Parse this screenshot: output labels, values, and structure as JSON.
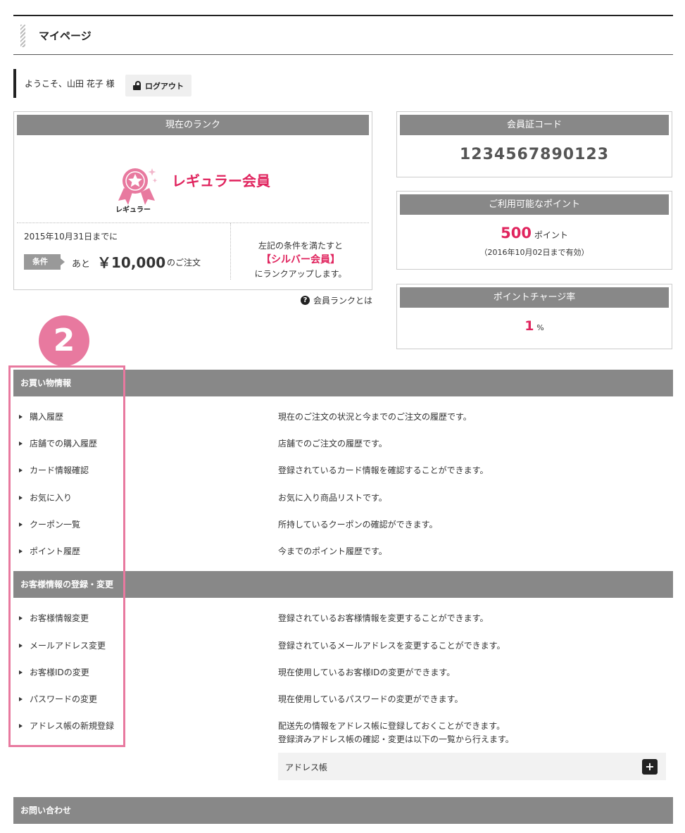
{
  "page": {
    "title": "マイページ"
  },
  "user": {
    "greeting": "ようこそ、山田 花子 様",
    "logout_label": "ログアウト"
  },
  "rank": {
    "header": "現在のランク",
    "badge_text": "レギュラー",
    "name": "レギュラー会員",
    "deadline": "2015年10月31日までに",
    "condition_label": "条件",
    "remain_prefix": "あと",
    "remain_amount": "￥10,000",
    "remain_suffix": "のご注文",
    "upgrade_line1": "左記の条件を満たすと",
    "upgrade_next": "【シルバー会員】",
    "upgrade_line2": "にランクアップします。",
    "help_label": "会員ランクとは",
    "colors": {
      "accent": "#e0245e",
      "badge": "#e8799f"
    }
  },
  "member_code": {
    "header": "会員証コード",
    "value": "1234567890123"
  },
  "points": {
    "header": "ご利用可能なポイント",
    "value": "500",
    "unit": "ポイント",
    "expiry": "（2016年10月02日まで有効）"
  },
  "charge_rate": {
    "header": "ポイントチャージ率",
    "value": "1",
    "unit": "%"
  },
  "step_marker": "2",
  "sections": {
    "shopping": {
      "title": "お買い物情報",
      "items": [
        {
          "label": "購入履歴",
          "desc": "現在のご注文の状況と今までのご注文の履歴です。"
        },
        {
          "label": "店舗での購入履歴",
          "desc": "店舗でのご注文の履歴です。"
        },
        {
          "label": "カード情報確認",
          "desc": "登録されているカード情報を確認することができます。"
        },
        {
          "label": "お気に入り",
          "desc": "お気に入り商品リストです。"
        },
        {
          "label": "クーポン一覧",
          "desc": "所持しているクーポンの確認ができます。"
        },
        {
          "label": "ポイント履歴",
          "desc": "今までのポイント履歴です。"
        }
      ]
    },
    "customer": {
      "title": "お客様情報の登録・変更",
      "items": [
        {
          "label": "お客様情報変更",
          "desc": "登録されているお客様情報を変更することができます。"
        },
        {
          "label": "メールアドレス変更",
          "desc": "登録されているメールアドレスを変更することができます。"
        },
        {
          "label": "お客様IDの変更",
          "desc": "現在使用しているお客様IDの変更ができます。"
        },
        {
          "label": "パスワードの変更",
          "desc": "現在使用しているパスワードの変更ができます。"
        },
        {
          "label": "アドレス帳の新規登録",
          "desc": "配送先の情報をアドレス帳に登録しておくことができます。",
          "desc2": "登録済みアドレス帳の確認・変更は以下の一覧から行えます。"
        }
      ],
      "address_book_label": "アドレス帳"
    },
    "contact": {
      "title": "お問い合わせ"
    }
  }
}
